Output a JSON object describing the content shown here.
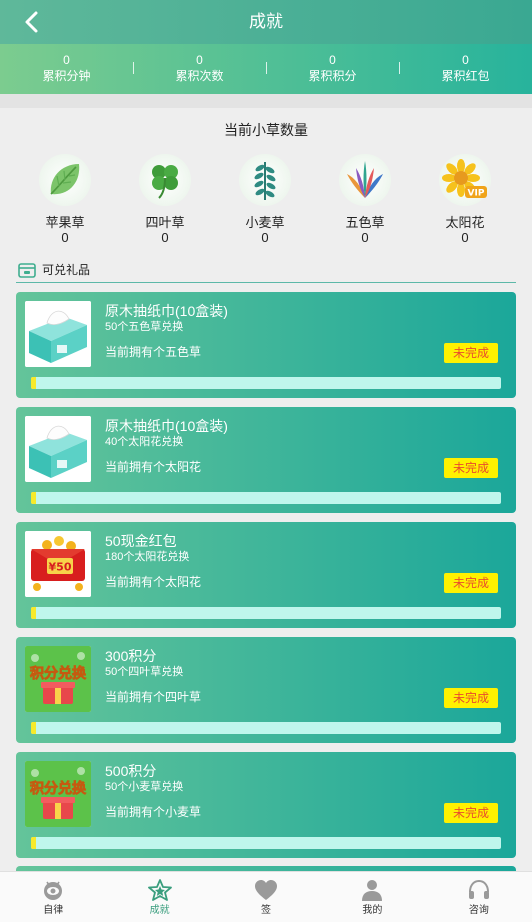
{
  "header": {
    "title": "成就",
    "back_icon": "chevron-left-icon"
  },
  "stats": [
    {
      "value": "0",
      "label": "累积分钟"
    },
    {
      "value": "0",
      "label": "累积次数"
    },
    {
      "value": "0",
      "label": "累积积分"
    },
    {
      "value": "0",
      "label": "累积红包"
    }
  ],
  "grass_section": {
    "title": "当前小草数量",
    "items": [
      {
        "name": "苹果草",
        "count": "0",
        "icon": "leaf-icon"
      },
      {
        "name": "四叶草",
        "count": "0",
        "icon": "clover-icon"
      },
      {
        "name": "小麦草",
        "count": "0",
        "icon": "wheat-grass-icon"
      },
      {
        "name": "五色草",
        "count": "0",
        "icon": "five-color-grass-icon"
      },
      {
        "name": "太阳花",
        "count": "0",
        "icon": "sunflower-vip-icon"
      }
    ]
  },
  "gifts": {
    "title": "可兑礼品",
    "items": [
      {
        "title": "原木抽纸巾(10盒装)",
        "sub": "50个五色草兑换",
        "own": "当前拥有个五色草",
        "status": "未完成",
        "thumb": "tissue-box",
        "progress": 0
      },
      {
        "title": "原木抽纸巾(10盒装)",
        "sub": "40个太阳花兑换",
        "own": "当前拥有个太阳花",
        "status": "未完成",
        "thumb": "tissue-box",
        "progress": 0
      },
      {
        "title": "50现金红包",
        "sub": "180个太阳花兑换",
        "own": "当前拥有个太阳花",
        "status": "未完成",
        "thumb": "red-envelope",
        "thumb_text": "¥50",
        "progress": 0
      },
      {
        "title": "300积分",
        "sub": "50个四叶草兑换",
        "own": "当前拥有个四叶草",
        "status": "未完成",
        "thumb": "points-exchange",
        "thumb_text": "积分兑换",
        "progress": 0
      },
      {
        "title": "500积分",
        "sub": "50个小麦草兑换",
        "own": "当前拥有个小麦草",
        "status": "未完成",
        "thumb": "points-exchange",
        "thumb_text": "积分兑换",
        "progress": 0
      }
    ]
  },
  "tabbar": [
    {
      "label": "自律",
      "icon": "eye-icon",
      "active": false
    },
    {
      "label": "成就",
      "icon": "star-icon",
      "active": true
    },
    {
      "label": "签",
      "icon": "heart-icon",
      "active": false
    },
    {
      "label": "我的",
      "icon": "person-icon",
      "active": false
    },
    {
      "label": "咨询",
      "icon": "headset-icon",
      "active": false
    }
  ],
  "colors": {
    "accent": "#3aa892",
    "badge_bg": "#fff100",
    "badge_text": "#e94c2c",
    "progress_track": "#bff6ec",
    "progress_fill": "#f7ea2a"
  }
}
